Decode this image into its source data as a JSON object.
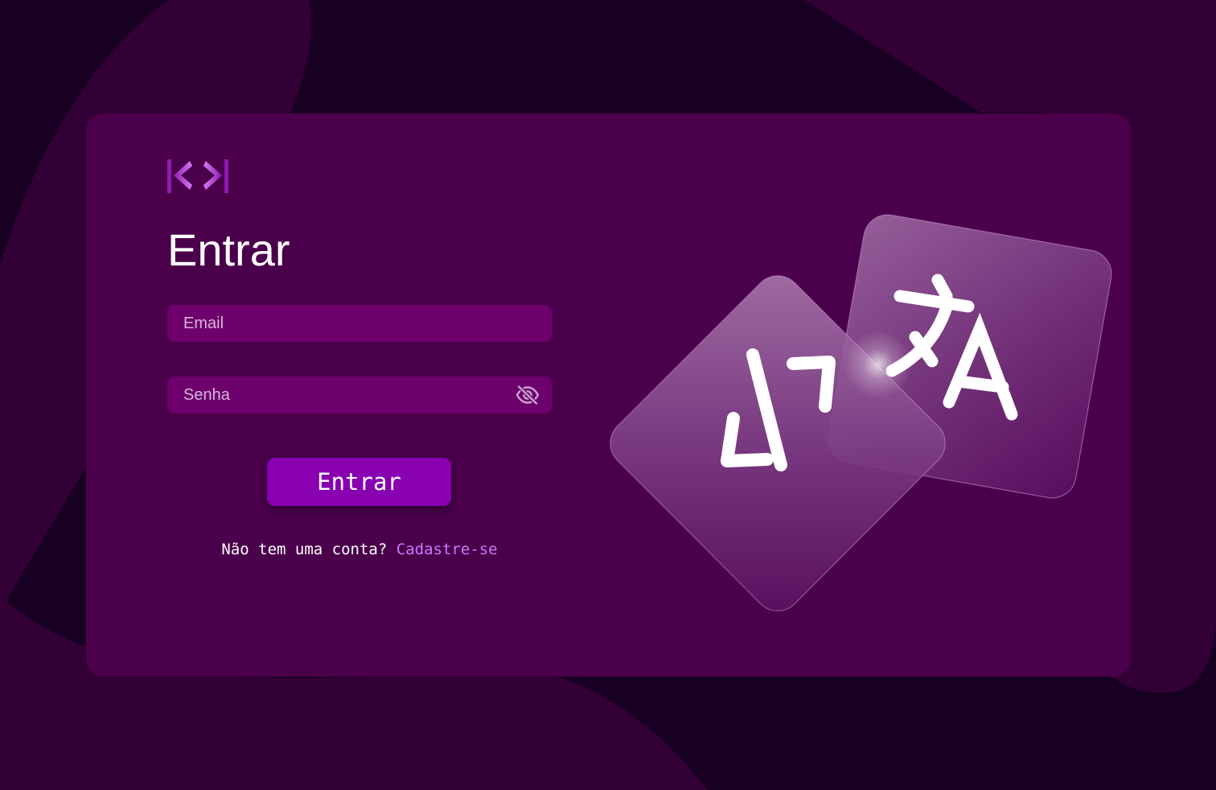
{
  "login": {
    "title": "Entrar",
    "email_placeholder": "Email",
    "password_placeholder": "Senha",
    "submit_label": "Entrar",
    "signup_prompt": "Não tem uma conta? ",
    "signup_link": "Cadastre-se"
  },
  "icons": {
    "logo": "code-brackets-logo",
    "password_toggle": "eye-off-icon",
    "illustration_front": "code-icon",
    "illustration_back": "translate-icon"
  },
  "colors": {
    "page_background": "#180022",
    "card_background": "#4b004b",
    "input_background": "#6d006d",
    "button_background": "#8800b0",
    "link": "#c77bff",
    "text": "#ffffff"
  }
}
